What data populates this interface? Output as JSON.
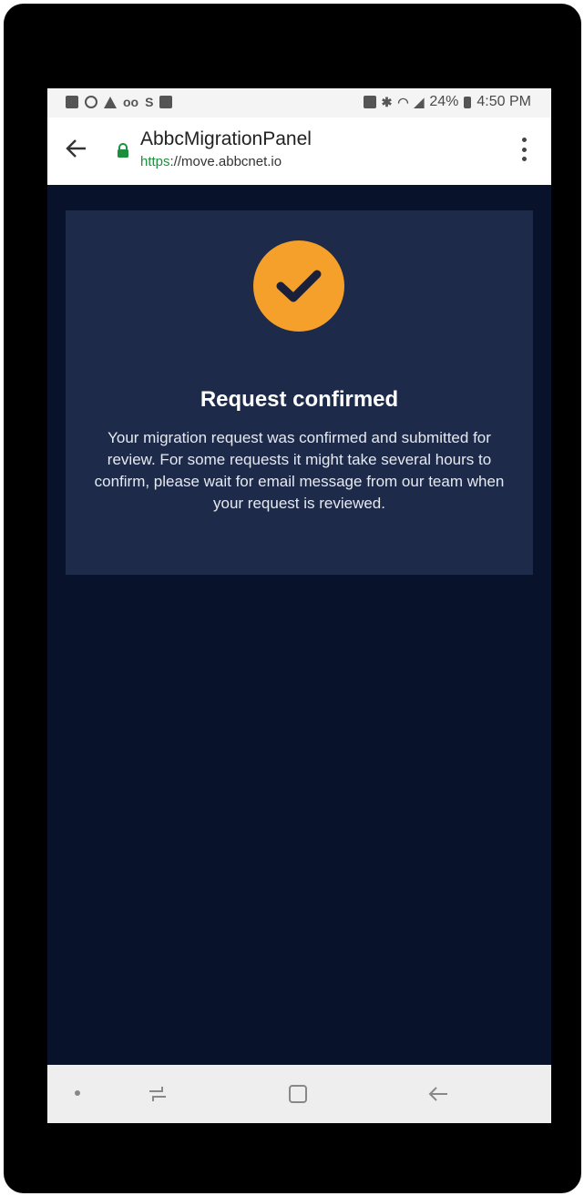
{
  "status_bar": {
    "battery": "24%",
    "time": "4:50 PM",
    "icons": [
      "message-icon",
      "whatsapp-icon",
      "warning-icon",
      "voicemail-icon",
      "s-icon",
      "image-icon",
      "cast-icon",
      "bluetooth-icon",
      "wifi-icon",
      "signal-icon",
      "battery-icon"
    ]
  },
  "browser": {
    "title": "AbbcMigrationPanel",
    "url_protocol": "https",
    "url_rest": "://move.abbcnet.io"
  },
  "card": {
    "badge_icon": "check-icon",
    "title": "Request confirmed",
    "message": "Your migration request was confirmed and submitted for review. For some requests it might take several hours to confirm, please wait for email message from our team when your request is reviewed."
  },
  "colors": {
    "page_background": "#08132b",
    "card_background": "#1d2a49",
    "accent": "#f4a02a",
    "secure_green": "#1e8e3e"
  }
}
